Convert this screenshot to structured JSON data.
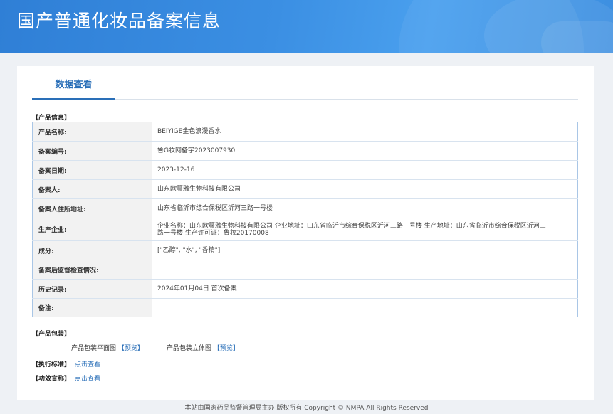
{
  "header": {
    "title": "国产普通化妆品备案信息"
  },
  "tabs": [
    {
      "label": "数据查看"
    }
  ],
  "product_info": {
    "section_label": "【产品信息】",
    "rows": [
      {
        "key": "产品名称:",
        "value": "BEIYIGE金色浪漫香水"
      },
      {
        "key": "备案编号:",
        "value": "鲁G妆网备字2023007930"
      },
      {
        "key": "备案日期:",
        "value": "2023-12-16"
      },
      {
        "key": "备案人:",
        "value": "山东欧蔓雅生物科技有限公司"
      },
      {
        "key": "备案人住所地址:",
        "value": "山东省临沂市综合保税区沂河三路一号楼"
      },
      {
        "key": "生产企业:",
        "value": "企业名称：山东欧蔓雅生物科技有限公司 企业地址：山东省临沂市综合保税区沂河三路一号楼 生产地址：山东省临沂市综合保税区沂河三路一号楼 生产许可证：鲁妆20170008"
      },
      {
        "key": "成分:",
        "value": "[\"乙醇\", \"水\", \"香精\"]"
      },
      {
        "key": "备案后监督检查情况:",
        "value": ""
      },
      {
        "key": "历史记录:",
        "value": "2024年01月04日 首次备案"
      },
      {
        "key": "备注:",
        "value": ""
      }
    ]
  },
  "packaging": {
    "section_label": "【产品包装】",
    "flat_label": "产品包装平面图",
    "flat_link": "【预览】",
    "solid_label": "产品包装立体图",
    "solid_link": "【预览】"
  },
  "standard": {
    "label": "【执行标准】",
    "link": "点击查看"
  },
  "efficacy": {
    "label": "【功效宣称】",
    "link": "点击查看"
  },
  "footer": {
    "text": "本站由国家药品监督管理局主办 版权所有 Copyright © NMPA All Rights Reserved"
  }
}
